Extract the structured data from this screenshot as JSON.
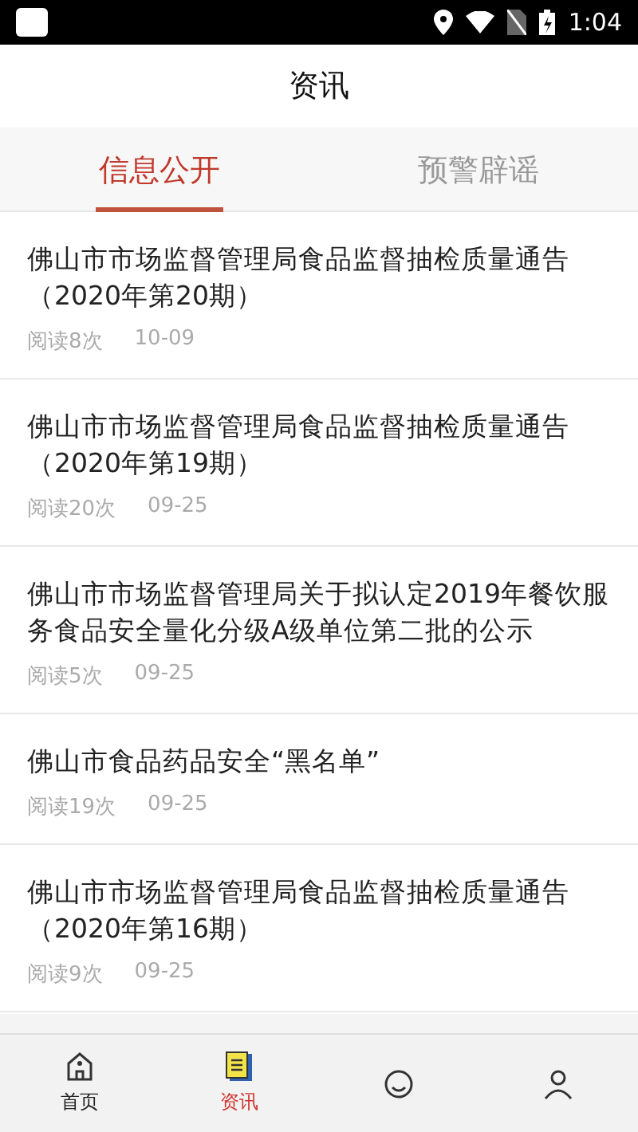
{
  "status_bar": {
    "time": "1:04"
  },
  "header": {
    "title": "资讯"
  },
  "tabs": [
    {
      "label": "信息公开",
      "selected": true
    },
    {
      "label": "预警辟谣",
      "selected": false
    }
  ],
  "articles": [
    {
      "title": "佛山市市场监督管理局食品监督抽检质量通告（2020年第20期）",
      "reads": "阅读8次",
      "date": "10-09"
    },
    {
      "title": "佛山市市场监督管理局食品监督抽检质量通告（2020年第19期）",
      "reads": "阅读20次",
      "date": "09-25"
    },
    {
      "title": "佛山市市场监督管理局关于拟认定2019年餐饮服务食品安全量化分级A级单位第二批的公示",
      "reads": "阅读5次",
      "date": "09-25"
    },
    {
      "title": "佛山市食品药品安全“黑名单”",
      "reads": "阅读19次",
      "date": "09-25"
    },
    {
      "title": "佛山市市场监督管理局食品监督抽检质量通告（2020年第16期）",
      "reads": "阅读9次",
      "date": "09-25"
    }
  ],
  "bottom_nav": [
    {
      "kind": "home",
      "label": "首页",
      "selected": false
    },
    {
      "kind": "news",
      "label": "资讯",
      "selected": true
    },
    {
      "kind": "face",
      "selected": false
    },
    {
      "kind": "person",
      "selected": false
    }
  ]
}
